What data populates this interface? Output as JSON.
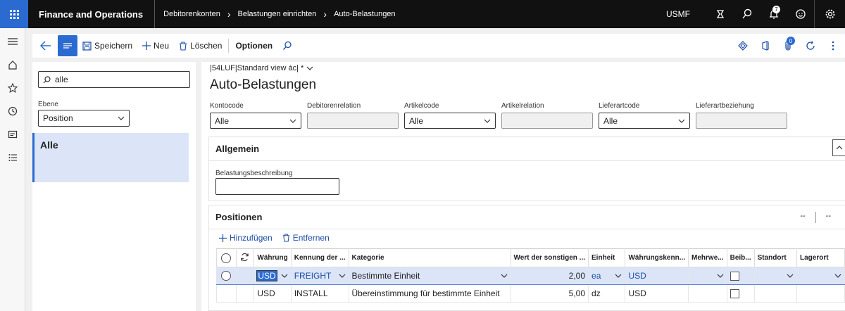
{
  "topbar": {
    "app_title": "Finance and Operations",
    "breadcrumbs": [
      "Debitorenkonten",
      "Belastungen einrichten",
      "Auto-Belastungen"
    ],
    "company": "USMF",
    "notification_count": "7"
  },
  "actions": {
    "save": "Speichern",
    "new": "Neu",
    "delete": "Löschen",
    "options": "Optionen",
    "attach_count": "0"
  },
  "listpane": {
    "search_value": "alle",
    "ebene_label": "Ebene",
    "ebene_value": "Position",
    "selected_item": "Alle"
  },
  "main": {
    "view_name": "|54LUF|Standard view ác| *",
    "title": "Auto-Belastungen",
    "filters": [
      {
        "label": "Kontocode",
        "value": "Alle"
      },
      {
        "label": "Debitorenrelation",
        "value": ""
      },
      {
        "label": "Artikelcode",
        "value": "Alle"
      },
      {
        "label": "Artikelrelation",
        "value": ""
      },
      {
        "label": "Lieferartcode",
        "value": "Alle"
      },
      {
        "label": "Lieferartbeziehung",
        "value": ""
      }
    ],
    "general": {
      "title": "Allgemein",
      "desc_label": "Belastungsbeschreibung",
      "desc_value": ""
    },
    "positions": {
      "title": "Positionen",
      "right_a": "--",
      "right_b": "--",
      "add": "Hinzufügen",
      "remove": "Entfernen",
      "columns": [
        "Währung",
        "Kennung der ...",
        "Kategorie",
        "Wert der sonstigen ...",
        "Einheit",
        "Währungskenn...",
        "Mehrwe...",
        "Beib...",
        "Standort",
        "Lagerort"
      ],
      "rows": [
        {
          "currency": "USD",
          "code": "FREIGHT",
          "category": "Bestimmte Einheit",
          "value": "2,00",
          "unit": "ea",
          "cur_code": "USD"
        },
        {
          "currency": "USD",
          "code": "INSTALL",
          "category": "Übereinstimmung für bestimmte Einheit",
          "value": "5,00",
          "unit": "dz",
          "cur_code": "USD"
        }
      ]
    }
  },
  "colors": {
    "accent": "#2a6ad1",
    "topbar": "#111111",
    "selection": "#dbe5f7"
  }
}
